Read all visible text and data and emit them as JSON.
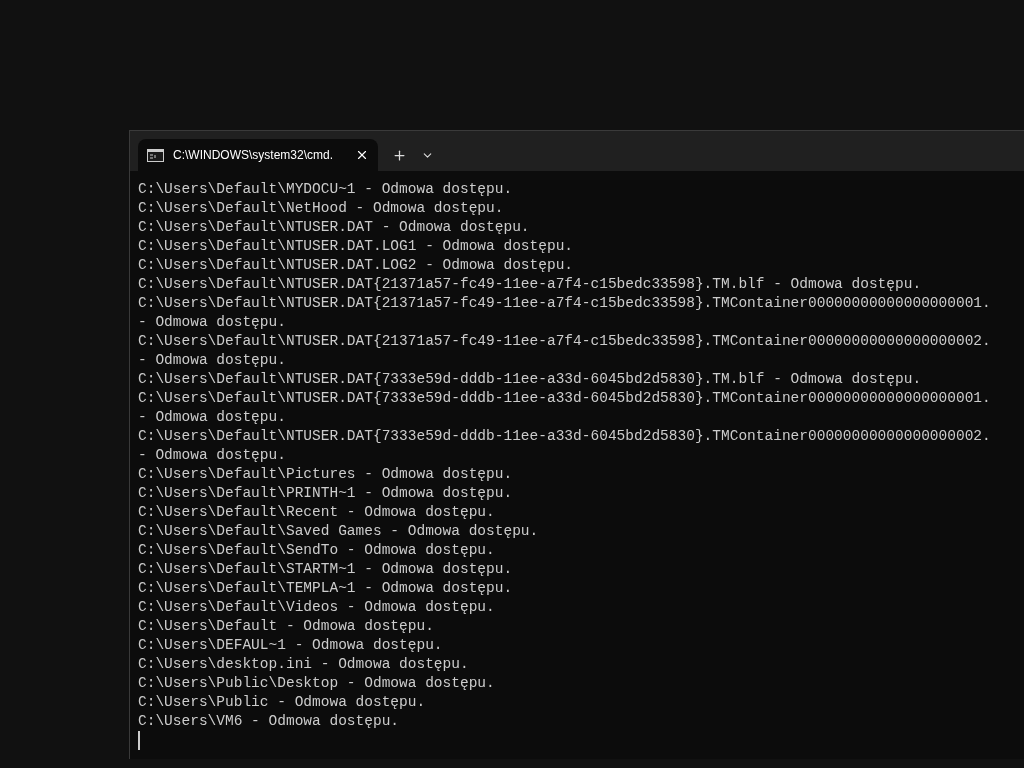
{
  "tabs": [
    {
      "label": "C:\\WINDOWS\\system32\\cmd.",
      "selected": true
    }
  ],
  "lines": [
    "C:\\Users\\Default\\MYDOCU~1 - Odmowa dostępu.",
    "C:\\Users\\Default\\NetHood - Odmowa dostępu.",
    "C:\\Users\\Default\\NTUSER.DAT - Odmowa dostępu.",
    "C:\\Users\\Default\\NTUSER.DAT.LOG1 - Odmowa dostępu.",
    "C:\\Users\\Default\\NTUSER.DAT.LOG2 - Odmowa dostępu.",
    "C:\\Users\\Default\\NTUSER.DAT{21371a57-fc49-11ee-a7f4-c15bedc33598}.TM.blf - Odmowa dostępu.",
    "C:\\Users\\Default\\NTUSER.DAT{21371a57-fc49-11ee-a7f4-c15bedc33598}.TMContainer00000000000000000001.",
    "- Odmowa dostępu.",
    "C:\\Users\\Default\\NTUSER.DAT{21371a57-fc49-11ee-a7f4-c15bedc33598}.TMContainer00000000000000000002.",
    "- Odmowa dostępu.",
    "C:\\Users\\Default\\NTUSER.DAT{7333e59d-dddb-11ee-a33d-6045bd2d5830}.TM.blf - Odmowa dostępu.",
    "C:\\Users\\Default\\NTUSER.DAT{7333e59d-dddb-11ee-a33d-6045bd2d5830}.TMContainer00000000000000000001.",
    "- Odmowa dostępu.",
    "C:\\Users\\Default\\NTUSER.DAT{7333e59d-dddb-11ee-a33d-6045bd2d5830}.TMContainer00000000000000000002.",
    "- Odmowa dostępu.",
    "C:\\Users\\Default\\Pictures - Odmowa dostępu.",
    "C:\\Users\\Default\\PRINTH~1 - Odmowa dostępu.",
    "C:\\Users\\Default\\Recent - Odmowa dostępu.",
    "C:\\Users\\Default\\Saved Games - Odmowa dostępu.",
    "C:\\Users\\Default\\SendTo - Odmowa dostępu.",
    "C:\\Users\\Default\\STARTM~1 - Odmowa dostępu.",
    "C:\\Users\\Default\\TEMPLA~1 - Odmowa dostępu.",
    "C:\\Users\\Default\\Videos - Odmowa dostępu.",
    "C:\\Users\\Default - Odmowa dostępu.",
    "C:\\Users\\DEFAUL~1 - Odmowa dostępu.",
    "C:\\Users\\desktop.ini - Odmowa dostępu.",
    "C:\\Users\\Public\\Desktop - Odmowa dostępu.",
    "C:\\Users\\Public - Odmowa dostępu.",
    "C:\\Users\\VM6 - Odmowa dostępu."
  ]
}
